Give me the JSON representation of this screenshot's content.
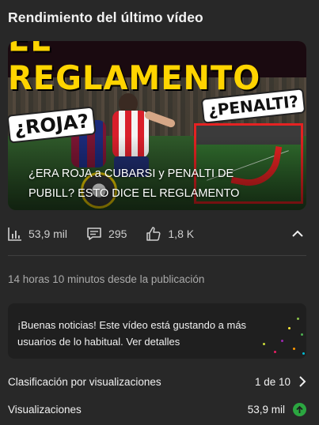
{
  "header": {
    "title": "Rendimiento del último vídeo"
  },
  "video": {
    "thumbnail_banner": "EL REGLAMENTO",
    "thumbnail_left_label": "¿ROJA?",
    "thumbnail_right_label": "¿PENALTI?",
    "title": "¿ERA ROJA a CUBARSI y PENALTI DE PUBILL? ESTO DICE EL REGLAMENTO"
  },
  "stats": {
    "views": "53,9 mil",
    "comments": "295",
    "likes": "1,8 K",
    "views_icon": "bar-chart-icon",
    "comments_icon": "comment-icon",
    "likes_icon": "thumbs-up-icon",
    "collapse_icon": "chevron-up-icon"
  },
  "published": {
    "text": "14 horas 10 minutos desde la publicación"
  },
  "notice": {
    "text": "¡Buenas noticias! Este vídeo está gustando a más usuarios de lo habitual. Ver detalles"
  },
  "metrics": [
    {
      "label": "Clasificación por visualizaciones",
      "value": "1 de 10",
      "icon": "chevron-right-icon"
    },
    {
      "label": "Visualizaciones",
      "value": "53,9 mil",
      "icon": "arrow-up-circle-icon"
    }
  ],
  "colors": {
    "background": "#282828",
    "card": "#1f1f1f",
    "up_badge": "#2ba640",
    "banner_yellow": "#ffd400"
  }
}
